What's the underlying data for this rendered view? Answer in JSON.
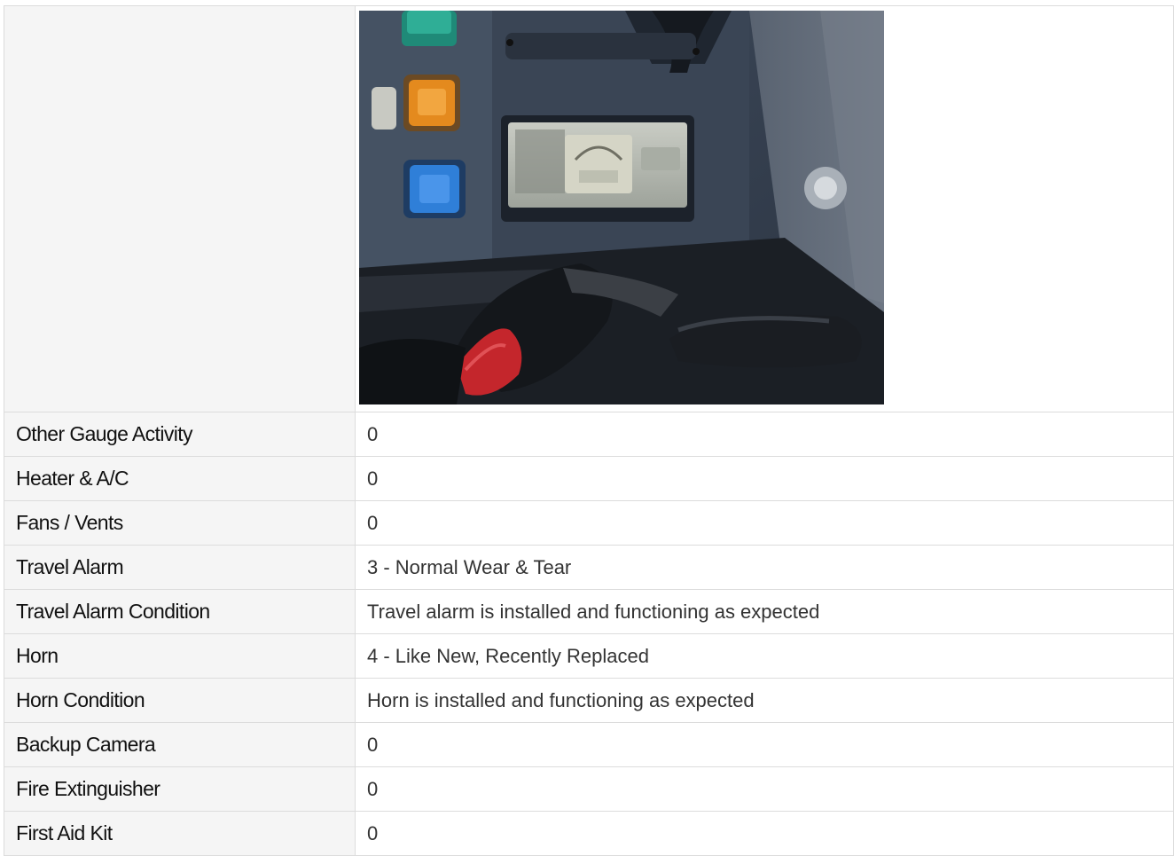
{
  "inspection": {
    "photo": {
      "label": "",
      "icon": "dashboard-photo-image"
    },
    "rows": [
      {
        "label": "Other Gauge Activity",
        "value": "0"
      },
      {
        "label": "Heater & A/C",
        "value": "0"
      },
      {
        "label": "Fans / Vents",
        "value": "0"
      },
      {
        "label": "Travel Alarm",
        "value": "3 - Normal Wear & Tear"
      },
      {
        "label": "Travel Alarm Condition",
        "value": "Travel alarm is installed and functioning as expected"
      },
      {
        "label": "Horn",
        "value": "4 - Like New, Recently Replaced"
      },
      {
        "label": "Horn Condition",
        "value": "Horn is installed and functioning as expected"
      },
      {
        "label": "Backup Camera",
        "value": "0"
      },
      {
        "label": "Fire Extinguisher",
        "value": "0"
      },
      {
        "label": "First Aid Kit",
        "value": "0"
      }
    ]
  }
}
